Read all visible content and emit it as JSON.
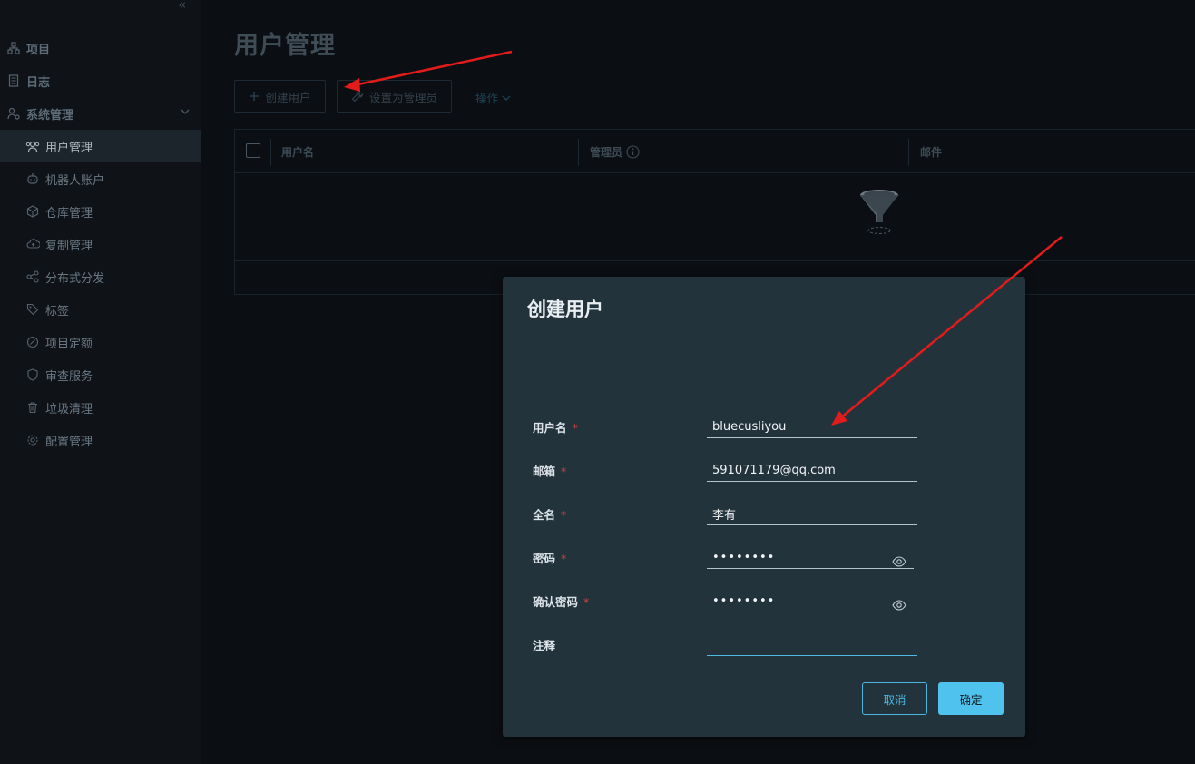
{
  "sidebar": {
    "collapse_glyph": "«",
    "top_items": [
      {
        "label": "项目",
        "icon": "project-icon"
      },
      {
        "label": "日志",
        "icon": "log-icon"
      },
      {
        "label": "系统管理",
        "icon": "admin-icon"
      }
    ],
    "sub_items": [
      {
        "label": "用户管理",
        "icon": "users-icon",
        "active": true
      },
      {
        "label": "机器人账户",
        "icon": "robot-icon"
      },
      {
        "label": "仓库管理",
        "icon": "registry-icon"
      },
      {
        "label": "复制管理",
        "icon": "replication-icon"
      },
      {
        "label": "分布式分发",
        "icon": "distribution-icon"
      },
      {
        "label": "标签",
        "icon": "tag-icon"
      },
      {
        "label": "项目定额",
        "icon": "quota-icon"
      },
      {
        "label": "审查服务",
        "icon": "shield-icon"
      },
      {
        "label": "垃圾清理",
        "icon": "trash-icon"
      },
      {
        "label": "配置管理",
        "icon": "gear-icon"
      }
    ]
  },
  "page": {
    "title": "用户管理",
    "toolbar": {
      "create_user": "创建用户",
      "set_admin": "设置为管理员",
      "actions": "操作"
    },
    "table": {
      "columns": [
        "用户名",
        "管理员",
        "邮件"
      ]
    }
  },
  "modal": {
    "title": "创建用户",
    "fields": {
      "username": {
        "label": "用户名",
        "value": "bluecusliyou"
      },
      "email": {
        "label": "邮箱",
        "value": "591071179@qq.com"
      },
      "fullname": {
        "label": "全名",
        "value": "李有"
      },
      "password": {
        "label": "密码",
        "value": "••••••••"
      },
      "confirm": {
        "label": "确认密码",
        "value": "••••••••"
      },
      "comment": {
        "label": "注释",
        "value": ""
      }
    },
    "required_mark": "*",
    "cancel": "取消",
    "ok": "确定"
  },
  "colors": {
    "accent": "#4fc3ee",
    "annotation_arrow": "#e31b1b",
    "modal_bg": "#23333c"
  }
}
